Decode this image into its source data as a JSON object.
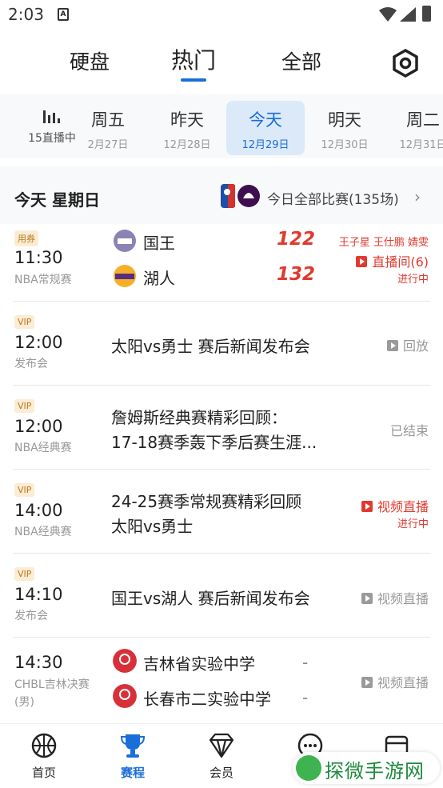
{
  "status_bar": {
    "time": "2:03",
    "sim_icon_letter": "A"
  },
  "top_tabs": [
    {
      "label": "硬盘"
    },
    {
      "label": "热门"
    },
    {
      "label": "全部"
    }
  ],
  "active_top_tab": "热门",
  "live": {
    "label": "15直播中"
  },
  "days": [
    {
      "name": "周五",
      "date": "2月27日"
    },
    {
      "name": "昨天",
      "date": "12月28日"
    },
    {
      "name": "今天",
      "date": "12月29日"
    },
    {
      "name": "明天",
      "date": "12月30日"
    },
    {
      "name": "周二",
      "date": "12月31日"
    }
  ],
  "header": {
    "title": "今天 星期日",
    "all_games": "今日全部比赛(135场)",
    "chevron": "›"
  },
  "rows": [
    {
      "tag": "用券",
      "time": "11:30",
      "sub": "NBA常规赛",
      "team1": "国王",
      "score1": "122",
      "team2": "湖人",
      "score2": "132",
      "commentators": "王子星 王仕鹏 婧雯",
      "status": "直播间(6)",
      "status2": "进行中"
    },
    {
      "tag": "VIP",
      "time": "12:00",
      "sub": "发布会",
      "title": "太阳vs勇士 赛后新闻发布会",
      "status": "回放"
    },
    {
      "tag": "VIP",
      "time": "12:00",
      "sub": "NBA经典赛",
      "title": "詹姆斯经典赛精彩回顾：",
      "title2": "17-18赛季轰下季后赛生涯...",
      "status": "已结束"
    },
    {
      "tag": "VIP",
      "time": "14:00",
      "sub": "NBA经典赛",
      "title": "24-25赛季常规赛精彩回顾",
      "title2": "太阳vs勇士",
      "status": "视频直播",
      "status2": "进行中"
    },
    {
      "tag": "VIP",
      "time": "14:10",
      "sub": "发布会",
      "title": "国王vs湖人 赛后新闻发布会",
      "status": "视频直播"
    },
    {
      "time": "14:30",
      "sub": "CHBL吉林决赛",
      "sub2": "(男)",
      "team1": "吉林省实验中学",
      "score1": "-",
      "team2": "长春市二实验中学",
      "score2": "-",
      "status": "视频直播"
    }
  ],
  "bottom_nav": [
    {
      "label": "首页"
    },
    {
      "label": "赛程"
    },
    {
      "label": "会员"
    },
    {
      "label": ""
    },
    {
      "label": ""
    }
  ],
  "watermark": {
    "text": "探微手游网"
  },
  "colors": {
    "accent": "#1a6ed8",
    "live_red": "#e03a2e",
    "vip_bg": "#fbecd3"
  }
}
